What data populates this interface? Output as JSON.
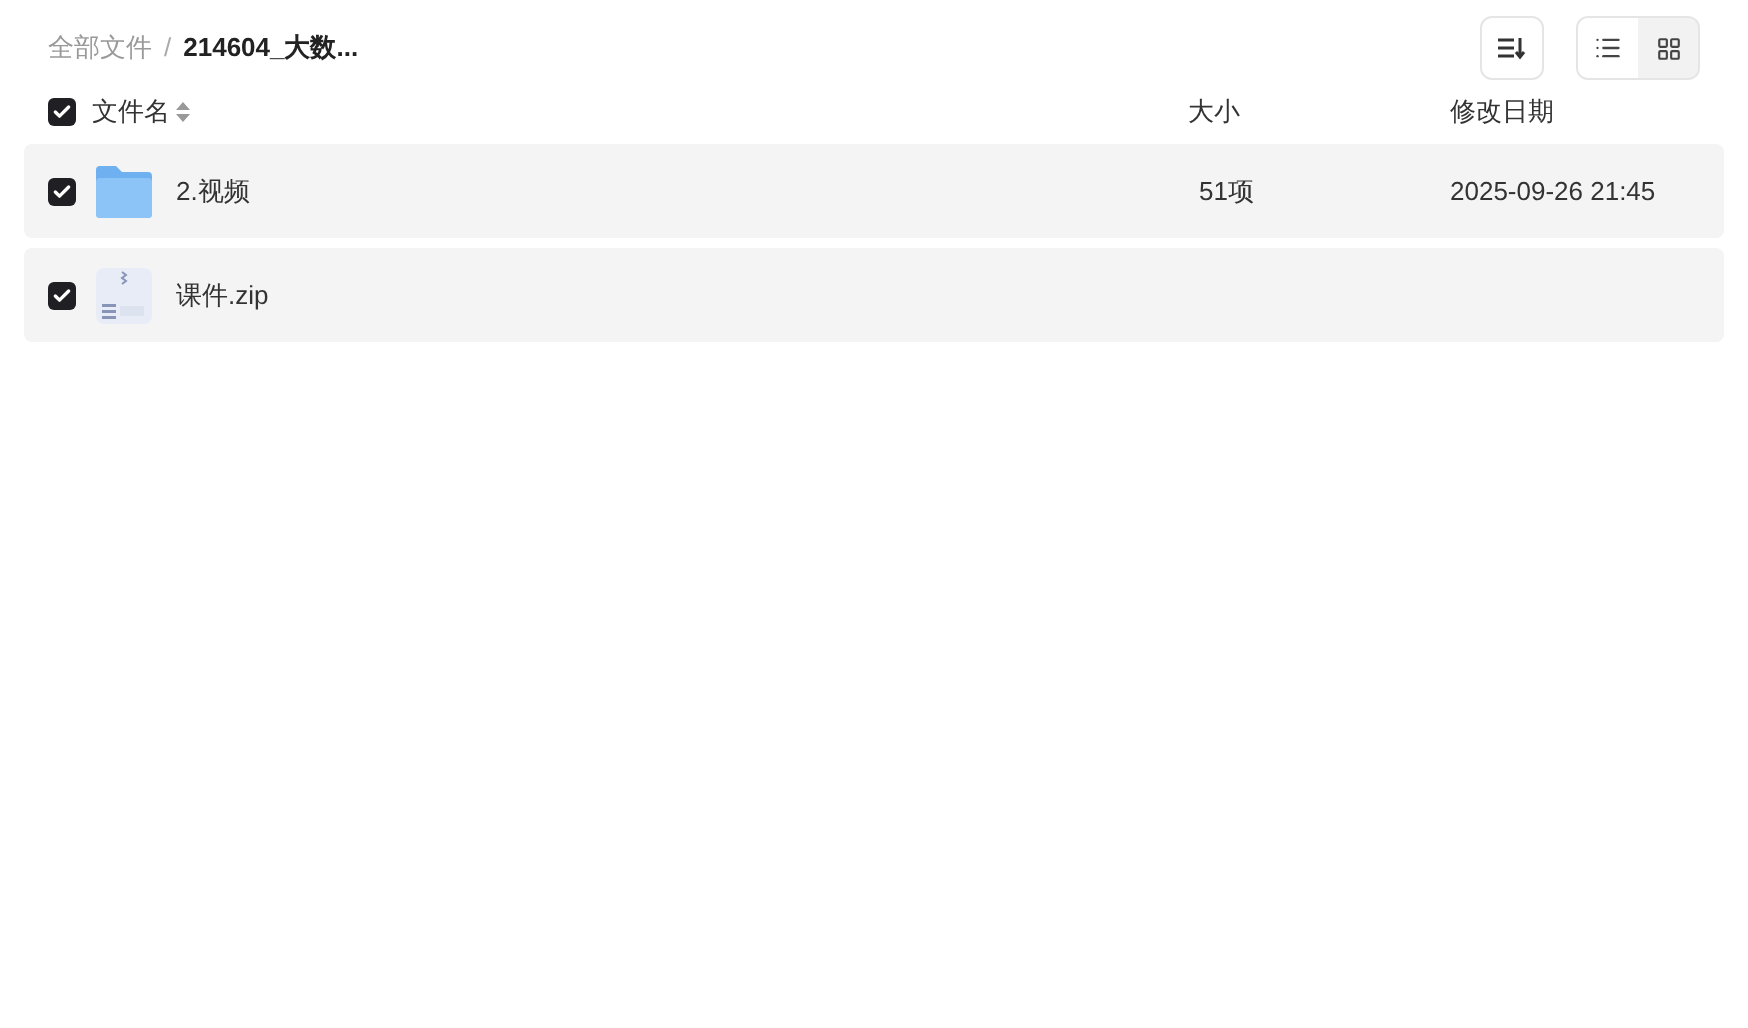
{
  "breadcrumb_separator": "/",
  "breadcrumb": [
    {
      "label": "全部文件",
      "current": false
    },
    {
      "label": "214604_大数...",
      "current": true
    }
  ],
  "view_toggle": [
    {
      "kind": "list",
      "selected": true
    },
    {
      "kind": "grid",
      "selected": false
    }
  ],
  "table": {
    "select_all": {
      "checked": true
    },
    "columns": [
      "文件名",
      "大小",
      "修改日期"
    ],
    "rows": [
      {
        "kind": "folder",
        "checked": true,
        "name": "2.视频",
        "size": "51项",
        "date": "2025-09-26 21:45"
      },
      {
        "kind": "zip",
        "checked": true,
        "name": "课件.zip"
      }
    ]
  }
}
